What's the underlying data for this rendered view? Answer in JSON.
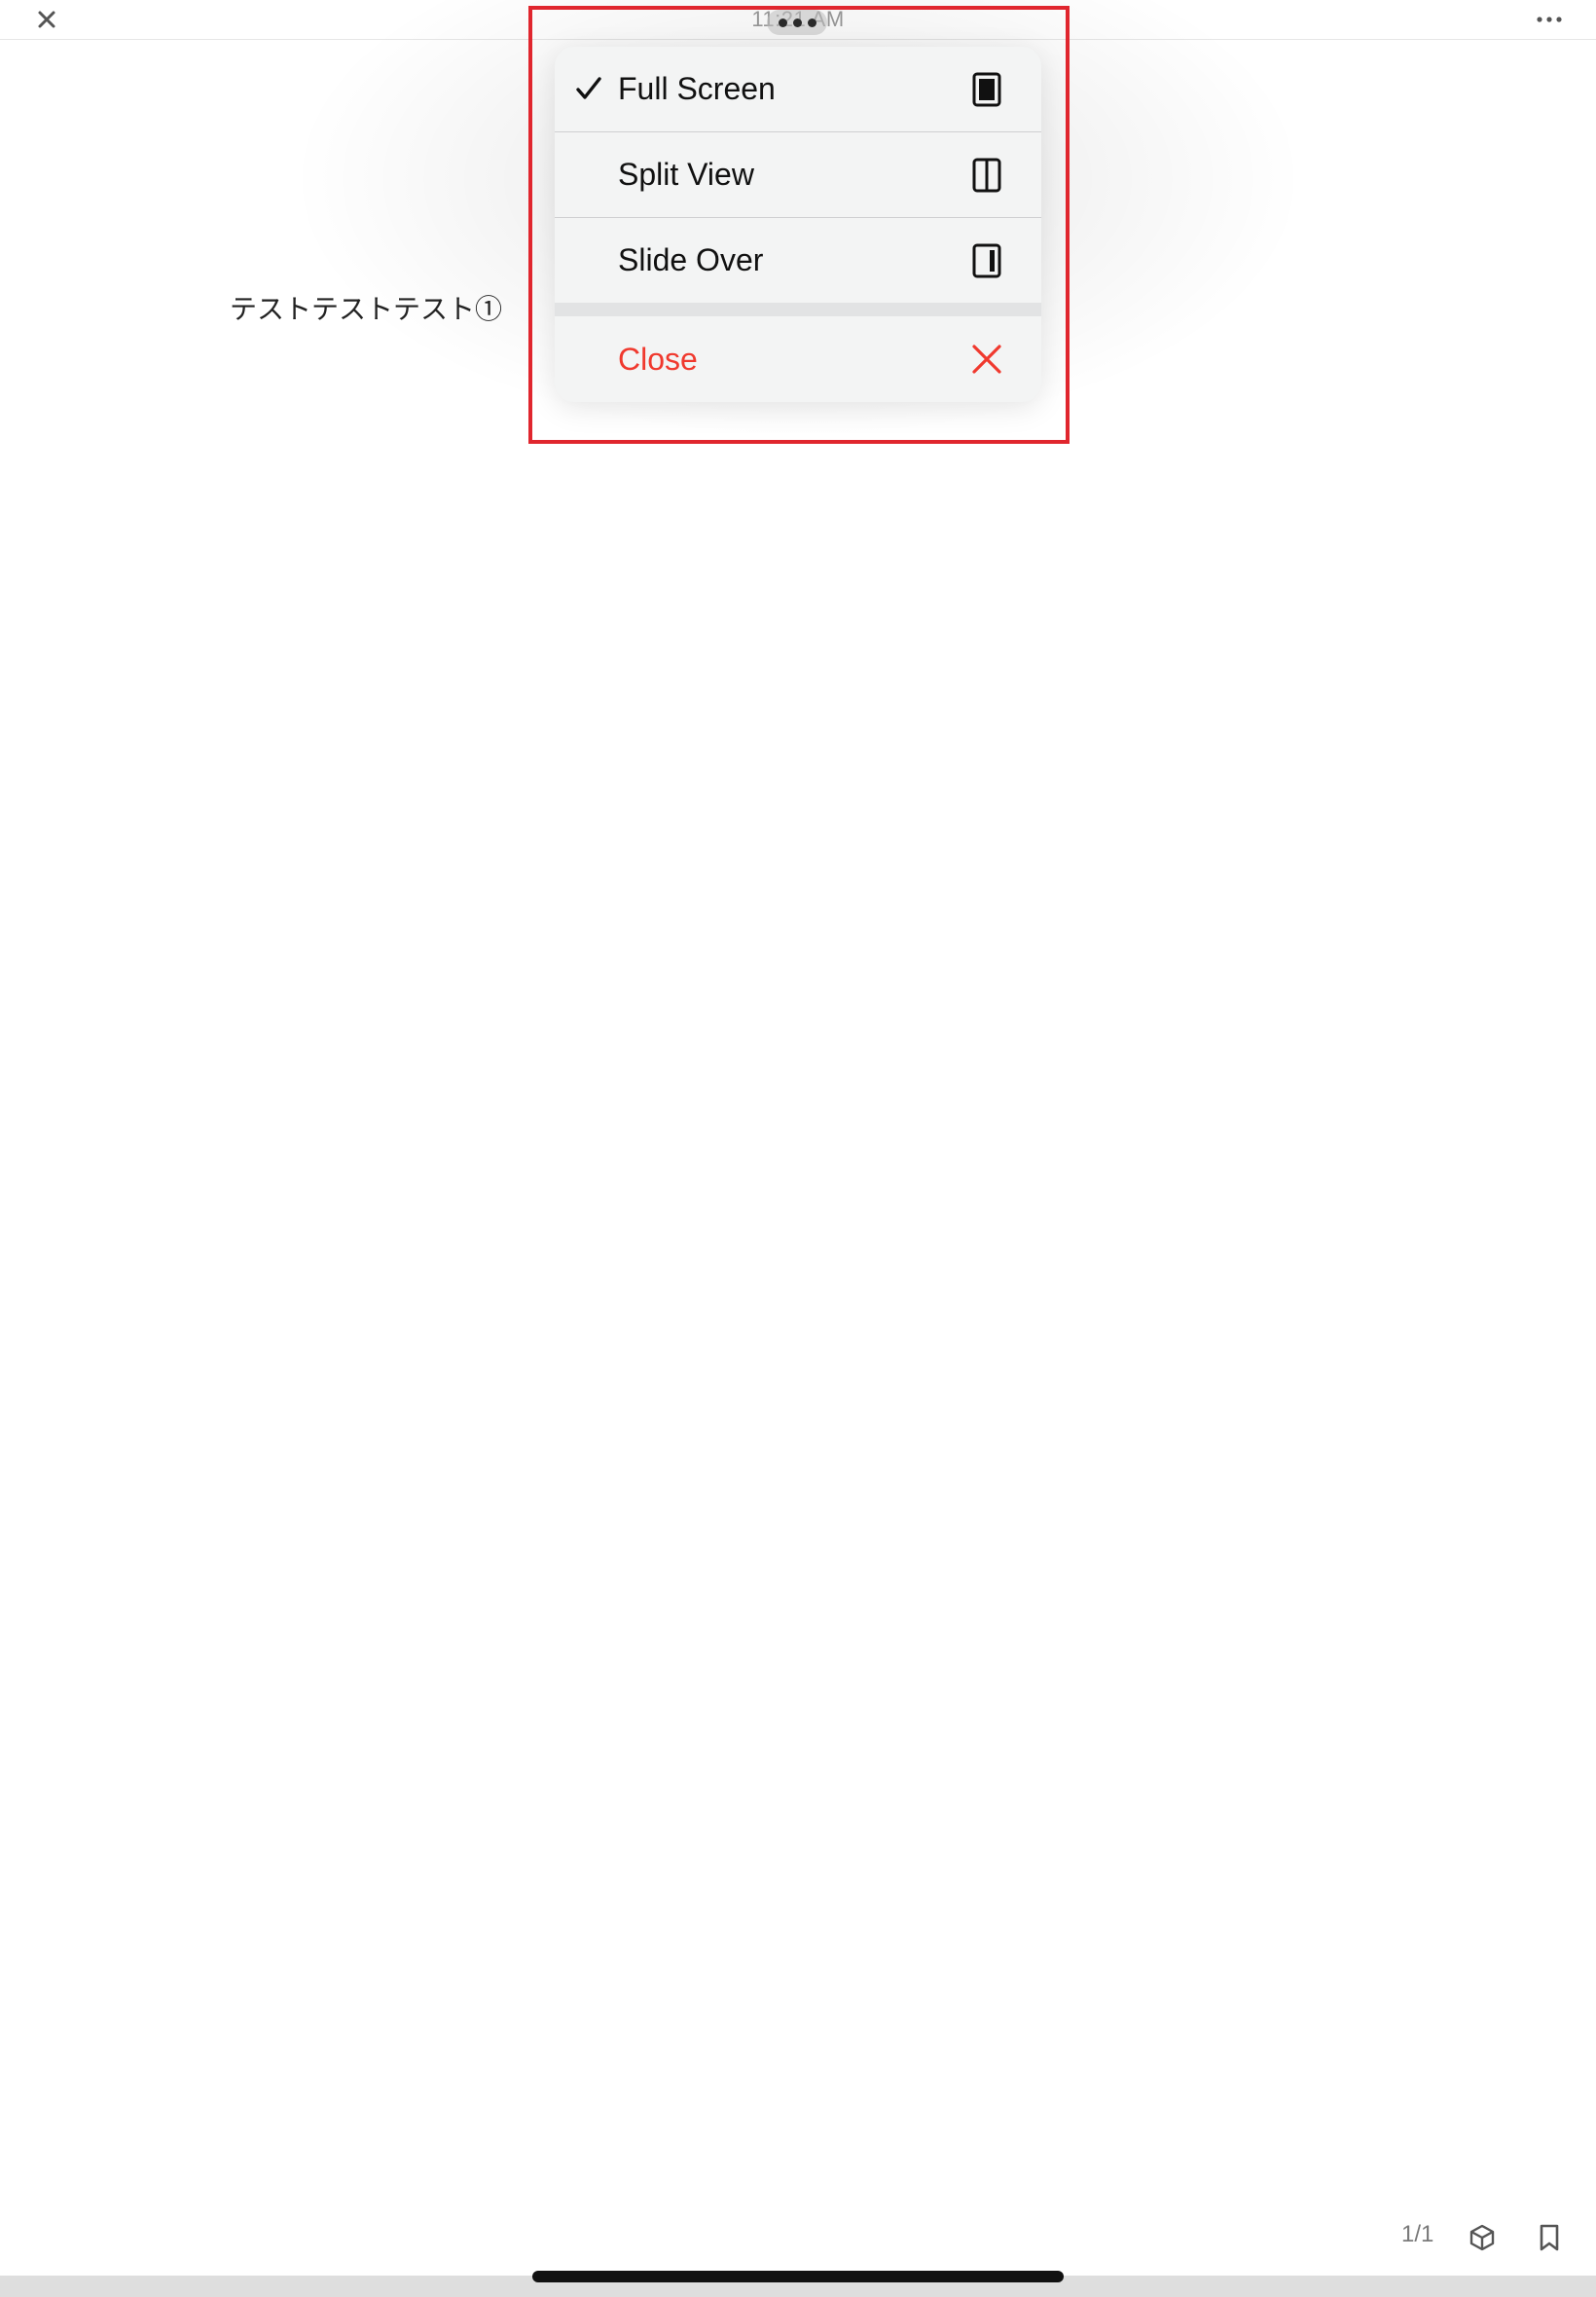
{
  "status_bar": {
    "time": "11:21 AM"
  },
  "document": {
    "text": "テストテストテスト①"
  },
  "multitasking_menu": {
    "items": [
      {
        "label": "Full Screen",
        "icon": "full-screen-icon",
        "checked": true
      },
      {
        "label": "Split View",
        "icon": "split-view-icon",
        "checked": false
      },
      {
        "label": "Slide Over",
        "icon": "slide-over-icon",
        "checked": false
      }
    ],
    "close": {
      "label": "Close",
      "icon": "close-x-icon",
      "color": "#f0392e"
    }
  },
  "bottom_toolbar": {
    "page_indicator": "1/1",
    "icons": [
      "cube-icon",
      "bookmark-icon"
    ]
  },
  "colors": {
    "highlight": "#e0262e",
    "destructive": "#f0392e"
  }
}
